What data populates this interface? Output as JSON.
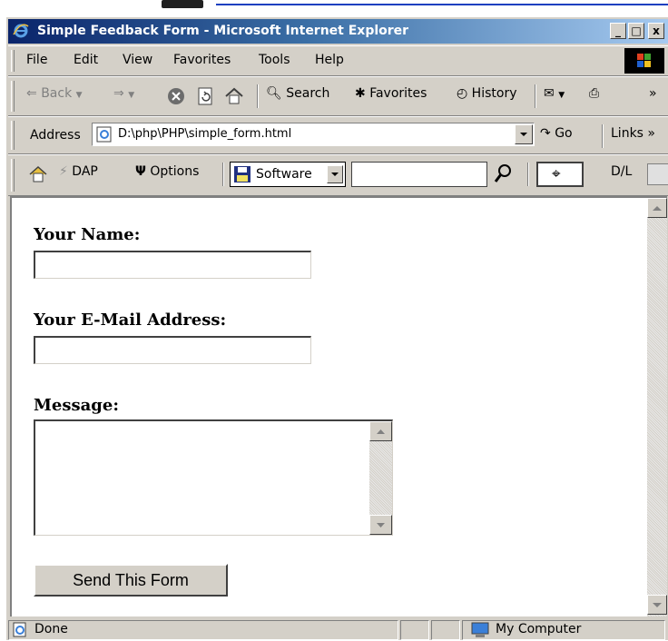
{
  "window": {
    "title": "Simple Feedback Form - Microsoft Internet Explorer",
    "buttons": {
      "minimize": "_",
      "maximize": "□",
      "close": "x"
    }
  },
  "menu": [
    "File",
    "Edit",
    "View",
    "Favorites",
    "Tools",
    "Help"
  ],
  "toolbar": {
    "back": "Back",
    "search": "Search",
    "favorites": "Favorites",
    "history": "History"
  },
  "address": {
    "label": "Address",
    "value": "D:\\php\\PHP\\simple_form.html",
    "go": "Go",
    "links": "Links"
  },
  "links_bar": {
    "dap": "DAP",
    "options": "Options",
    "software": "Software",
    "dl": "D/L"
  },
  "form": {
    "name_label": "Your Name:",
    "name_value": "",
    "email_label": "Your E-Mail Address:",
    "email_value": "",
    "message_label": "Message:",
    "message_value": "",
    "submit_label": "Send This Form"
  },
  "status": {
    "text": "Done",
    "zone": "My Computer"
  },
  "colors": {
    "titlebar_start": "#0a246a",
    "titlebar_end": "#a6caf0",
    "chrome": "#d4d0c8"
  }
}
